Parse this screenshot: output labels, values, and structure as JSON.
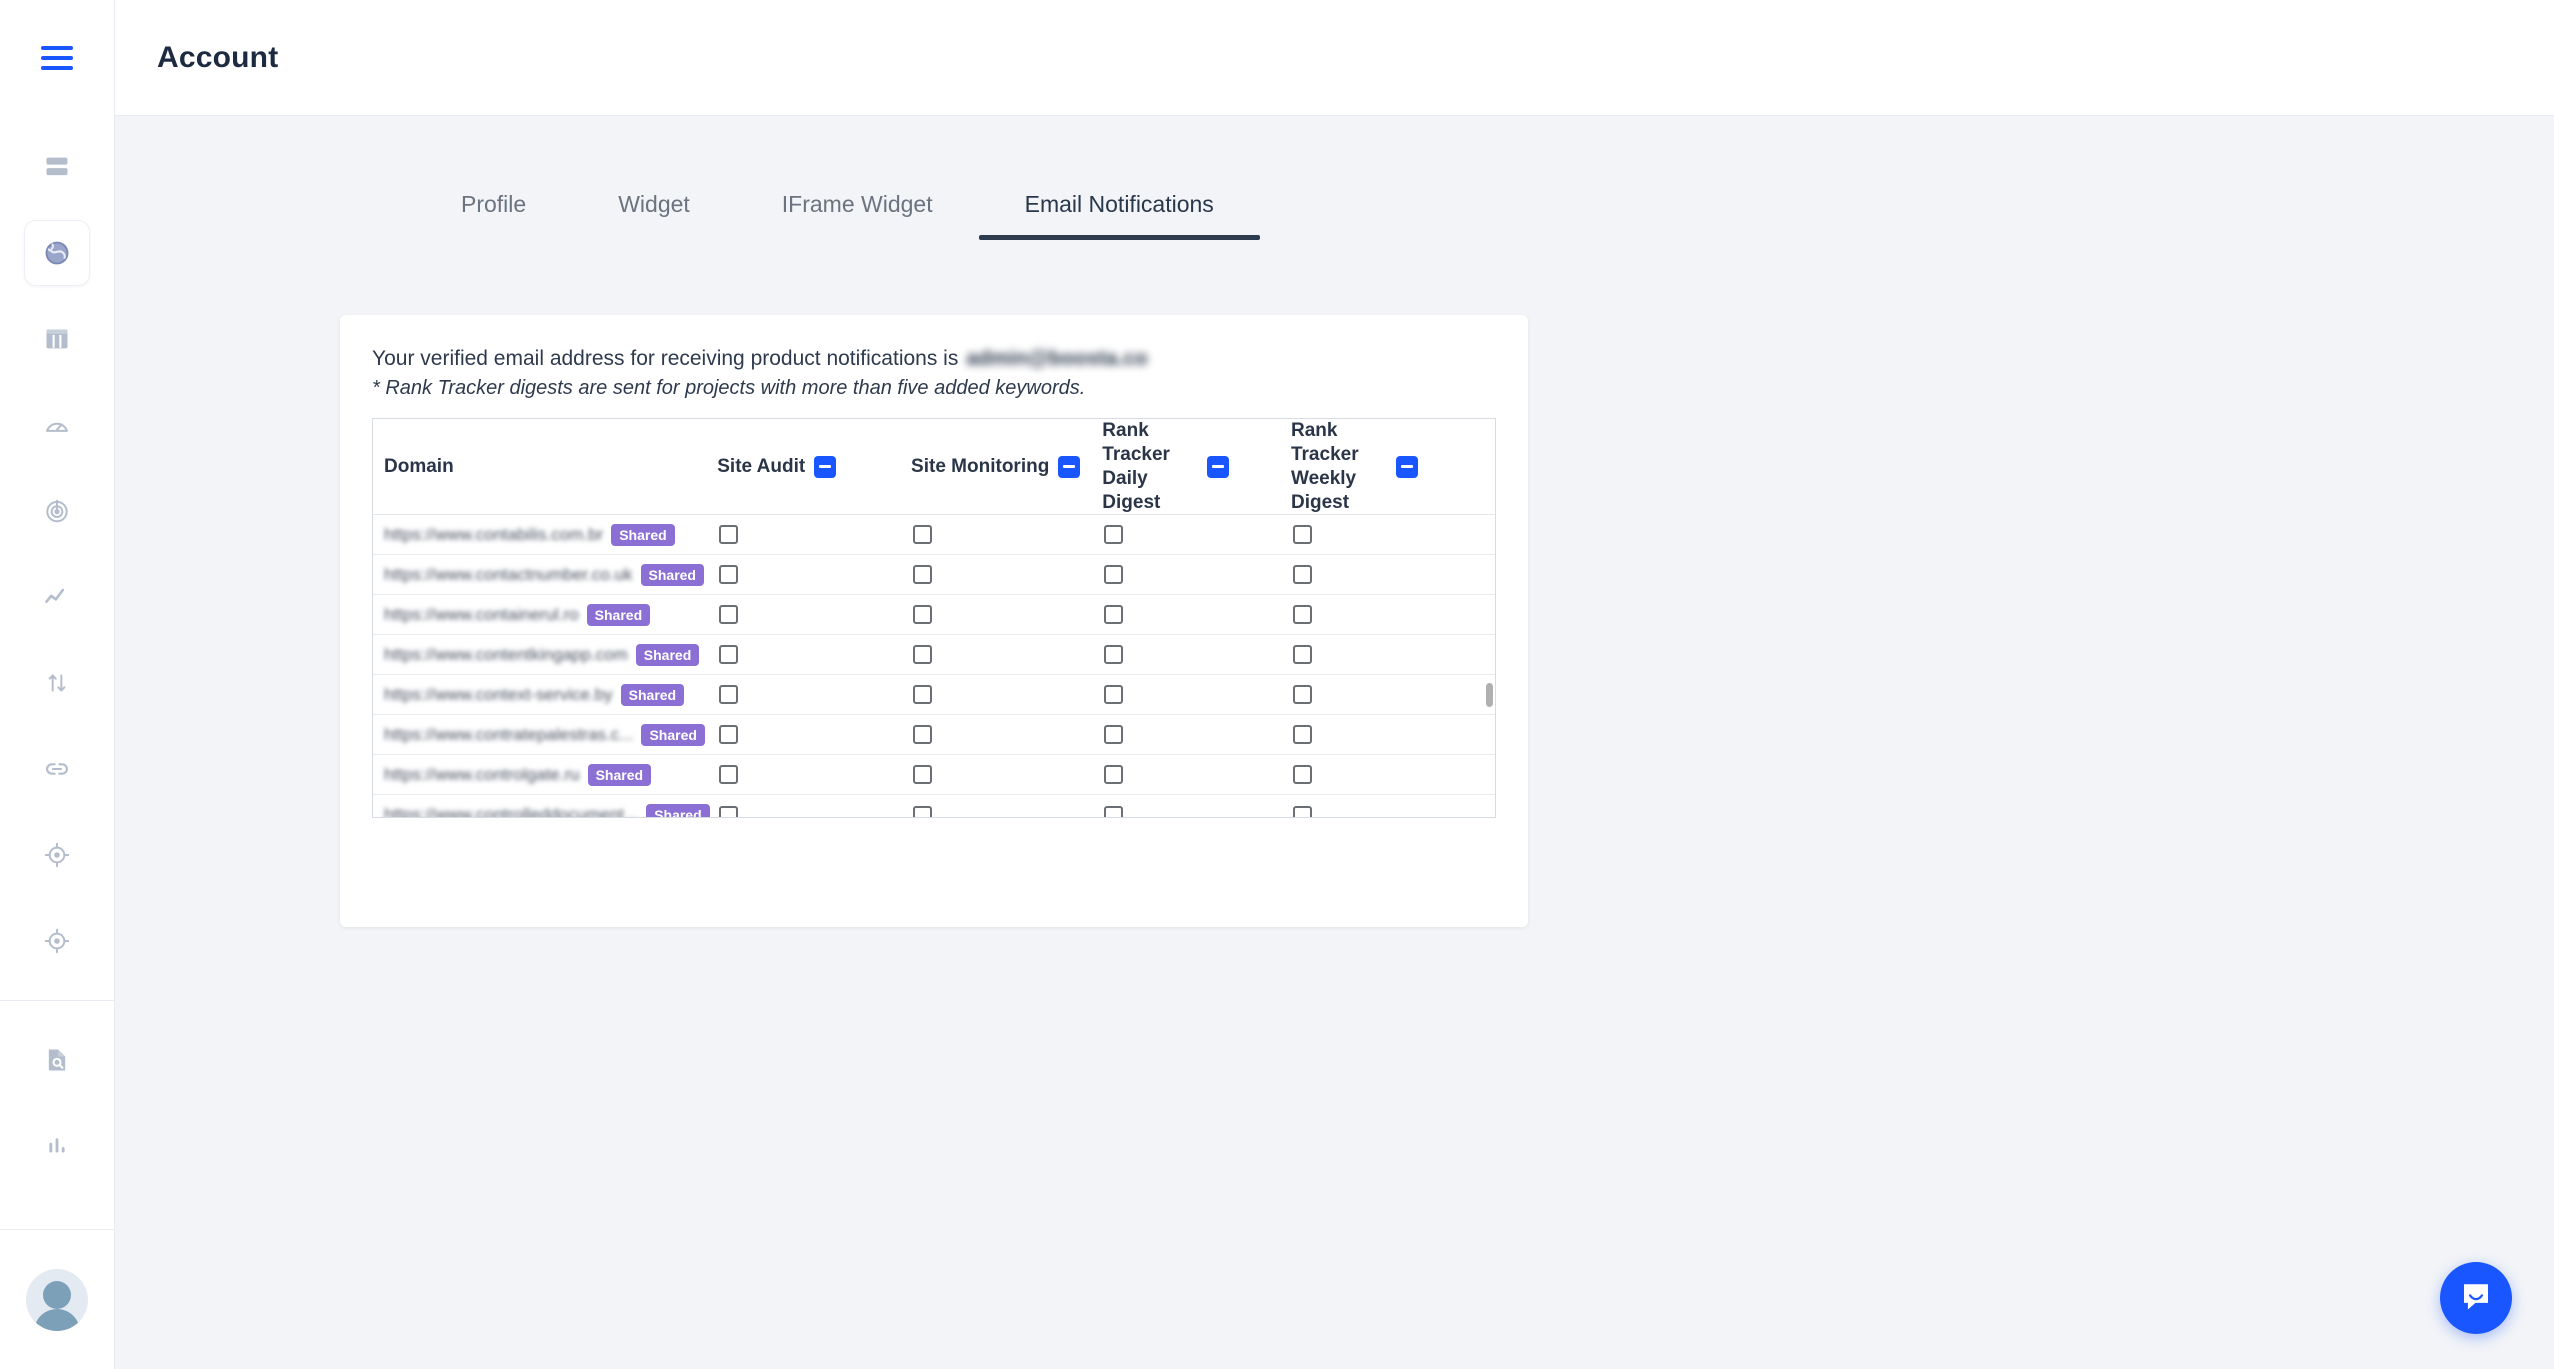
{
  "app": {
    "page_title": "Account",
    "menu_icon": "hamburger-icon"
  },
  "sidebar": {
    "items": [
      {
        "icon": "dashboard-icon",
        "active": false
      },
      {
        "icon": "globe-icon",
        "active": true
      },
      {
        "icon": "table-columns-icon",
        "active": false
      },
      {
        "icon": "speedometer-icon",
        "active": false
      },
      {
        "icon": "radar-icon",
        "active": false
      },
      {
        "icon": "line-chart-icon",
        "active": false
      },
      {
        "icon": "sort-arrows-icon",
        "active": false
      },
      {
        "icon": "link-icon",
        "active": false
      },
      {
        "icon": "target-icon",
        "active": false
      },
      {
        "icon": "target-crosshair-icon",
        "active": false
      },
      {
        "icon": "document-search-icon",
        "active": false
      },
      {
        "icon": "bar-chart-icon",
        "active": false
      }
    ],
    "avatar": "user-avatar"
  },
  "tabs": [
    {
      "label": "Profile",
      "active": false
    },
    {
      "label": "Widget",
      "active": false
    },
    {
      "label": "IFrame Widget",
      "active": false
    },
    {
      "label": "Email Notifications",
      "active": true
    }
  ],
  "card": {
    "verified_prefix": "Your verified email address for receiving product notifications is",
    "verified_email": "admin@boosta.co",
    "digest_note": "* Rank Tracker digests are sent for projects with more than five added keywords."
  },
  "table": {
    "columns": [
      {
        "key": "domain",
        "label": "Domain",
        "has_toggle": false
      },
      {
        "key": "site_audit",
        "label": "Site Audit",
        "has_toggle": true,
        "toggle_state": "indeterminate"
      },
      {
        "key": "site_monitoring",
        "label": "Site Monitoring",
        "has_toggle": true,
        "toggle_state": "indeterminate"
      },
      {
        "key": "rt_daily",
        "label": "Rank Tracker Daily Digest",
        "label_line1": "Rank Tracker",
        "label_line2": "Daily Digest",
        "has_toggle": true,
        "toggle_state": "indeterminate"
      },
      {
        "key": "rt_weekly",
        "label": "Rank Tracker Weekly Digest",
        "label_line1": "Rank Tracker",
        "label_line2": "Weekly Digest",
        "has_toggle": true,
        "toggle_state": "indeterminate"
      }
    ],
    "badge_label": "Shared",
    "rows": [
      {
        "domain": "https://www.contabilis.com.br",
        "badge": "Shared",
        "site_audit": false,
        "site_monitoring": false,
        "rt_daily": false,
        "rt_weekly": false
      },
      {
        "domain": "https://www.contactnumber.co.uk",
        "badge": "Shared",
        "site_audit": false,
        "site_monitoring": false,
        "rt_daily": false,
        "rt_weekly": false
      },
      {
        "domain": "https://www.containerul.ro",
        "badge": "Shared",
        "site_audit": false,
        "site_monitoring": false,
        "rt_daily": false,
        "rt_weekly": false
      },
      {
        "domain": "https://www.contentkingapp.com",
        "badge": "Shared",
        "site_audit": false,
        "site_monitoring": false,
        "rt_daily": false,
        "rt_weekly": false
      },
      {
        "domain": "https://www.context-service.by",
        "badge": "Shared",
        "site_audit": false,
        "site_monitoring": false,
        "rt_daily": false,
        "rt_weekly": false
      },
      {
        "domain": "https://www.contratepalestras.c...",
        "badge": "Shared",
        "site_audit": false,
        "site_monitoring": false,
        "rt_daily": false,
        "rt_weekly": false
      },
      {
        "domain": "https://www.controlgate.ru",
        "badge": "Shared",
        "site_audit": false,
        "site_monitoring": false,
        "rt_daily": false,
        "rt_weekly": false
      },
      {
        "domain": "https://www.controlleddocument...",
        "badge": "Shared",
        "site_audit": false,
        "site_monitoring": false,
        "rt_daily": false,
        "rt_weekly": false
      }
    ]
  },
  "intercom": {
    "icon": "chat-bubble-icon"
  },
  "colors": {
    "accent_blue": "#1a56ff",
    "badge_purple": "#8b6fd4",
    "page_bg": "#f2f4f7",
    "text_dark": "#2e3a4d",
    "tab_inactive": "#6b7380"
  }
}
